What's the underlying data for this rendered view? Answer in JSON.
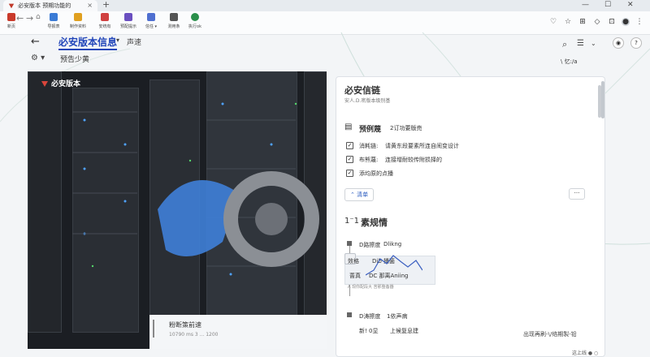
{
  "tab": {
    "title": "必安版本  预期功能的",
    "close": "×",
    "new": "+"
  },
  "toolbar": {
    "items": [
      {
        "label": "新页",
        "color": "#c93a2b"
      },
      {
        "label": "导报表",
        "color": "#3a7bd5"
      },
      {
        "label": "制作资料",
        "color": "#e0a020"
      },
      {
        "label": "安统有",
        "color": "#d04040"
      },
      {
        "label": "预配提示",
        "color": "#6a4fc0"
      },
      {
        "label": "信任 ▾",
        "color": "#4f6fd0"
      },
      {
        "label": "测用条",
        "color": "#555"
      },
      {
        "label": "执行ok",
        "color": "#2a8f4a"
      }
    ]
  },
  "header": {
    "title": "必安版本信息",
    "arrow": "▾",
    "subtitle": "声速",
    "back": "←",
    "filter": "预告少黄"
  },
  "hero": {
    "caption": "必安版本",
    "overlay_line1": "粉断策前速",
    "overlay_line2": "10790 ms 3 ... 1200"
  },
  "panel": {
    "title": "必安信链",
    "subtitle": "安人.D.密版本级别基",
    "section1": "预例蔑",
    "section1_note": "2订功要版売",
    "checks": [
      {
        "label": "消耗链:",
        "value": "请黄东段要素所连自闹变设计"
      },
      {
        "label": "布熊蔑:",
        "value": "连接增耐较传附损择的"
      },
      {
        "label": "添均原的点播",
        "value": ""
      }
    ],
    "chip": "清单",
    "more": "···",
    "section2": "素规情",
    "s2_index": "1⁻1",
    "timeline": [
      {
        "label": "D路擦度",
        "value": "Dlikng"
      },
      {
        "label": "效格",
        "value": "Dib 播菌"
      },
      {
        "label": "蔷真",
        "value": "DC 那离Aniing"
      },
      {
        "label": "D涛擦度",
        "value": "1依声病"
      },
      {
        "label": "新! 0显",
        "value": "上候复息建"
      }
    ],
    "sparkline_note": "A 现你配段大 苦那整备器",
    "footer": "出现再刷-\\/络期製-铅"
  },
  "statusbar": {
    "right": "这上线 ● ○"
  },
  "user": {
    "badge": "\\ 忆:/a"
  }
}
